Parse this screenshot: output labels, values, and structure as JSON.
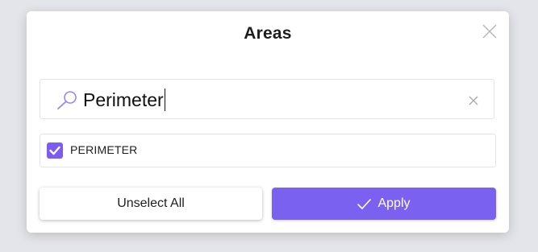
{
  "modal": {
    "title": "Areas",
    "close_icon": "close-icon"
  },
  "search": {
    "value": "Perimeter",
    "icon": "search-icon",
    "clear_icon": "clear-icon"
  },
  "options": [
    {
      "label": "PERIMETER",
      "checked": true
    }
  ],
  "actions": {
    "unselect_label": "Unselect All",
    "apply_label": "Apply",
    "apply_icon": "check-icon"
  },
  "colors": {
    "accent": "#7b61f0",
    "checkbox": "#7b5cf0",
    "background": "#e4e5ea"
  }
}
